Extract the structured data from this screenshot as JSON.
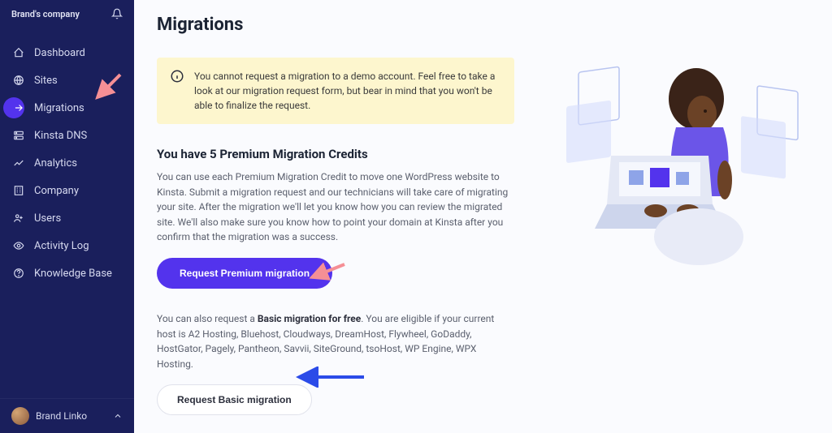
{
  "brand": {
    "company_label": "Brand's company"
  },
  "sidebar": {
    "items": [
      {
        "label": "Dashboard"
      },
      {
        "label": "Sites"
      },
      {
        "label": "Migrations"
      },
      {
        "label": "Kinsta DNS"
      },
      {
        "label": "Analytics"
      },
      {
        "label": "Company"
      },
      {
        "label": "Users"
      },
      {
        "label": "Activity Log"
      },
      {
        "label": "Knowledge Base"
      }
    ],
    "user": {
      "name": "Brand Linko"
    }
  },
  "page": {
    "title": "Migrations",
    "notice": "You cannot request a migration to a demo account. Feel free to take a look at our migration request form, but bear in mind that you won't be able to finalize the request.",
    "heading": "You have 5 Premium Migration Credits",
    "paragraph1": "You can use each Premium Migration Credit to move one WordPress website to Kinsta. Submit a migration request and our technicians will take care of migrating your site. After the migration we'll let you know how you can review the migrated site. We'll also make sure you know how to point your domain at Kinsta after you confirm that the migration was a success.",
    "btn_primary": "Request Premium migration",
    "paragraph2_pre": "You can also request a ",
    "paragraph2_bold": "Basic migration for free",
    "paragraph2_post": ". You are eligible if your current host is A2 Hosting, Bluehost, Cloudways, DreamHost, Flywheel, GoDaddy, HostGator, Pagely, Pantheon, Savvii, SiteGround, tsoHost, WP Engine, WPX Hosting.",
    "btn_secondary": "Request Basic migration"
  }
}
